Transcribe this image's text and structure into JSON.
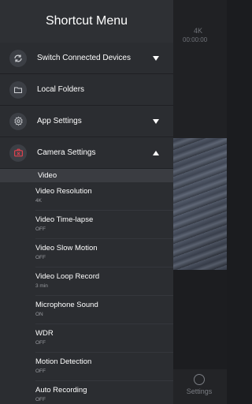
{
  "background": {
    "resolution_badge": "4K",
    "record_time": "00:00:00",
    "settings_label": "Settings"
  },
  "drawer": {
    "title": "Shortcut Menu",
    "items": [
      {
        "label": "Switch Connected Devices",
        "icon": "refresh-icon",
        "expandable": true,
        "expanded": false
      },
      {
        "label": "Local Folders",
        "icon": "folder-icon",
        "expandable": false
      },
      {
        "label": "App Settings",
        "icon": "gear-icon",
        "expandable": true,
        "expanded": false
      },
      {
        "label": "Camera Settings",
        "icon": "camera-icon",
        "expandable": true,
        "expanded": true
      }
    ],
    "camera_section": {
      "header": "Video",
      "settings": [
        {
          "label": "Video Resolution",
          "value": "4K"
        },
        {
          "label": "Video Time-lapse",
          "value": "OFF"
        },
        {
          "label": "Video Slow Motion",
          "value": "OFF"
        },
        {
          "label": "Video Loop Record",
          "value": "3 min"
        },
        {
          "label": "Microphone Sound",
          "value": "ON"
        },
        {
          "label": "WDR",
          "value": "OFF"
        },
        {
          "label": "Motion Detection",
          "value": "OFF"
        },
        {
          "label": "Auto Recording",
          "value": "OFF"
        }
      ]
    }
  },
  "colors": {
    "drawer_bg": "#2b2d31",
    "camera_icon_accent": "#e0424f"
  }
}
